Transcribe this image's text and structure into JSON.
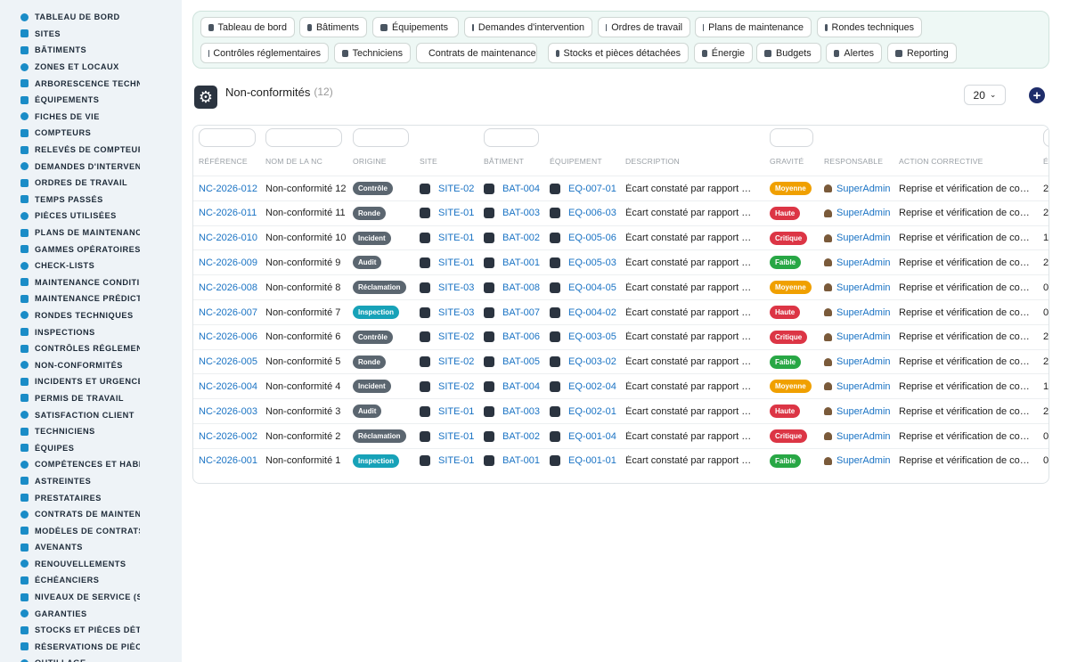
{
  "sidebar": {
    "items": [
      {
        "label": "TABLEAU DE BORD",
        "icon": "dashboard-icon"
      },
      {
        "label": "SITES",
        "icon": "map-pin-icon"
      },
      {
        "label": "BÂTIMENTS",
        "icon": "building-icon"
      },
      {
        "label": "ZONES ET LOCAUX",
        "icon": "map-icon"
      },
      {
        "label": "ARBORESCENCE TECHNIQUE",
        "icon": "tree-icon"
      },
      {
        "label": "ÉQUIPEMENTS",
        "icon": "cogs-icon"
      },
      {
        "label": "FICHES DE VIE",
        "icon": "history-icon"
      },
      {
        "label": "COMPTEURS",
        "icon": "gauge-icon"
      },
      {
        "label": "RELEVÉS DE COMPTEURS",
        "icon": "list-icon"
      },
      {
        "label": "DEMANDES D'INTERVENTION",
        "icon": "question-icon"
      },
      {
        "label": "ORDRES DE TRAVAIL",
        "icon": "clipboard-icon"
      },
      {
        "label": "TEMPS PASSÉS",
        "icon": "clock-icon"
      },
      {
        "label": "PIÈCES UTILISÉES",
        "icon": "boxes-icon"
      },
      {
        "label": "PLANS DE MAINTENANCE",
        "icon": "calendar-icon"
      },
      {
        "label": "GAMMES OPÉRATOIRES",
        "icon": "list-check-icon"
      },
      {
        "label": "CHECK-LISTS",
        "icon": "checklist-icon"
      },
      {
        "label": "MAINTENANCE CONDITIONNELLE",
        "icon": "thermometer-icon"
      },
      {
        "label": "MAINTENANCE PRÉDICTIVE",
        "icon": "chart-icon"
      },
      {
        "label": "RONDES TECHNIQUES",
        "icon": "route-icon"
      },
      {
        "label": "INSPECTIONS",
        "icon": "search-icon"
      },
      {
        "label": "CONTRÔLES RÉGLEMENTAIRES",
        "icon": "clipboard-check-icon"
      },
      {
        "label": "NON-CONFORMITÉS",
        "icon": "alert-circle-icon"
      },
      {
        "label": "INCIDENTS ET URGENCES",
        "icon": "warning-icon"
      },
      {
        "label": "PERMIS DE TRAVAIL",
        "icon": "document-icon"
      },
      {
        "label": "SATISFACTION CLIENT",
        "icon": "smile-icon"
      },
      {
        "label": "TECHNICIENS",
        "icon": "hard-hat-icon"
      },
      {
        "label": "ÉQUIPES",
        "icon": "users-icon"
      },
      {
        "label": "COMPÉTENCES ET HABILITATIONS",
        "icon": "award-icon"
      },
      {
        "label": "ASTREINTES",
        "icon": "phone-icon"
      },
      {
        "label": "PRESTATAIRES",
        "icon": "handshake-icon"
      },
      {
        "label": "CONTRATS DE MAINTENANCE",
        "icon": "contract-icon"
      },
      {
        "label": "MODÈLES DE CONTRATS",
        "icon": "file-icon"
      },
      {
        "label": "AVENANTS",
        "icon": "file-plus-icon"
      },
      {
        "label": "RENOUVELLEMENTS",
        "icon": "refresh-icon"
      },
      {
        "label": "ÉCHÉANCIERS",
        "icon": "calendar-alt-icon"
      },
      {
        "label": "NIVEAUX DE SERVICE (SLA)",
        "icon": "stopwatch-icon"
      },
      {
        "label": "GARANTIES",
        "icon": "shield-icon"
      },
      {
        "label": "STOCKS ET PIÈCES DÉTACHÉES",
        "icon": "warehouse-icon"
      },
      {
        "label": "RÉSERVATIONS DE PIÈCES",
        "icon": "bookmark-icon"
      },
      {
        "label": "OUTILLAGE",
        "icon": "tools-icon"
      }
    ]
  },
  "nav": {
    "row1": [
      {
        "label": "Tableau de bord",
        "icon": "dashboard-icon"
      },
      {
        "label": "Bâtiments",
        "icon": "building-icon"
      },
      {
        "label": "Équipements",
        "icon": "cogs-icon"
      },
      {
        "label": "Demandes d'intervention",
        "icon": "question-icon"
      },
      {
        "label": "Ordres de travail",
        "icon": "clipboard-icon"
      },
      {
        "label": "Plans de maintenance",
        "icon": "calendar-icon"
      },
      {
        "label": "Rondes techniques",
        "icon": "route-icon"
      }
    ],
    "row2": [
      {
        "label": "Contrôles réglementaires",
        "icon": "clipboard-check-icon"
      },
      {
        "label": "Techniciens",
        "icon": "hard-hat-icon"
      },
      {
        "label": "Contrats de maintenance",
        "icon": "contract-icon"
      },
      {
        "label": "Stocks et pièces détachées",
        "icon": "boxes-icon"
      },
      {
        "label": "Énergie",
        "icon": "bolt-icon"
      },
      {
        "label": "Budgets",
        "icon": "money-icon"
      },
      {
        "label": "Alertes",
        "icon": "bell-icon"
      },
      {
        "label": "Reporting",
        "icon": "pie-chart-icon"
      }
    ]
  },
  "page": {
    "title": "Non-conformités",
    "count": "(12)",
    "per_page": "20",
    "add_label": "+"
  },
  "table": {
    "headers": [
      "RÉFÉRENCE",
      "NOM DE LA NC",
      "ORIGINE",
      "SITE",
      "BÂTIMENT",
      "ÉQUIPEMENT",
      "DESCRIPTION",
      "GRAVITÉ",
      "RESPONSABLE",
      "ACTION CORRECTIVE",
      "É"
    ],
    "origin_colors": {
      "Contrôle": "#5b6670",
      "Ronde": "#5b6670",
      "Incident": "#5b6670",
      "Audit": "#5b6670",
      "Réclamation": "#5b6670",
      "Inspection": "#17a2b8"
    },
    "severity_colors": {
      "Moyenne": "#f0a000",
      "Haute": "#dc3545",
      "Critique": "#dc3545",
      "Faible": "#28a745"
    },
    "rows": [
      {
        "ref": "NC-2026-012",
        "name": "Non-conformité 12",
        "origin": "Contrôle",
        "site": "SITE-02",
        "bat": "BAT-004",
        "eq": "EQ-007-01",
        "desc": "Écart constaté par rapport aux exigences",
        "sev": "Moyenne",
        "resp": "SuperAdmin",
        "action": "Reprise et vérification de conformité",
        "extra": "2"
      },
      {
        "ref": "NC-2026-011",
        "name": "Non-conformité 11",
        "origin": "Ronde",
        "site": "SITE-01",
        "bat": "BAT-003",
        "eq": "EQ-006-03",
        "desc": "Écart constaté par rapport aux exigences",
        "sev": "Haute",
        "resp": "SuperAdmin",
        "action": "Reprise et vérification de conformité",
        "extra": "2"
      },
      {
        "ref": "NC-2026-010",
        "name": "Non-conformité 10",
        "origin": "Incident",
        "site": "SITE-01",
        "bat": "BAT-002",
        "eq": "EQ-005-06",
        "desc": "Écart constaté par rapport aux exigences",
        "sev": "Critique",
        "resp": "SuperAdmin",
        "action": "Reprise et vérification de conformité",
        "extra": "1"
      },
      {
        "ref": "NC-2026-009",
        "name": "Non-conformité 9",
        "origin": "Audit",
        "site": "SITE-01",
        "bat": "BAT-001",
        "eq": "EQ-005-03",
        "desc": "Écart constaté par rapport aux exigences",
        "sev": "Faible",
        "resp": "SuperAdmin",
        "action": "Reprise et vérification de conformité",
        "extra": "2"
      },
      {
        "ref": "NC-2026-008",
        "name": "Non-conformité 8",
        "origin": "Réclamation",
        "site": "SITE-03",
        "bat": "BAT-008",
        "eq": "EQ-004-05",
        "desc": "Écart constaté par rapport aux exigences",
        "sev": "Moyenne",
        "resp": "SuperAdmin",
        "action": "Reprise et vérification de conformité",
        "extra": "0"
      },
      {
        "ref": "NC-2026-007",
        "name": "Non-conformité 7",
        "origin": "Inspection",
        "site": "SITE-03",
        "bat": "BAT-007",
        "eq": "EQ-004-02",
        "desc": "Écart constaté par rapport aux exigences",
        "sev": "Haute",
        "resp": "SuperAdmin",
        "action": "Reprise et vérification de conformité",
        "extra": "0"
      },
      {
        "ref": "NC-2026-006",
        "name": "Non-conformité 6",
        "origin": "Contrôle",
        "site": "SITE-02",
        "bat": "BAT-006",
        "eq": "EQ-003-05",
        "desc": "Écart constaté par rapport aux exigences",
        "sev": "Critique",
        "resp": "SuperAdmin",
        "action": "Reprise et vérification de conformité",
        "extra": "2"
      },
      {
        "ref": "NC-2026-005",
        "name": "Non-conformité 5",
        "origin": "Ronde",
        "site": "SITE-02",
        "bat": "BAT-005",
        "eq": "EQ-003-02",
        "desc": "Écart constaté par rapport aux exigences",
        "sev": "Faible",
        "resp": "SuperAdmin",
        "action": "Reprise et vérification de conformité",
        "extra": "2"
      },
      {
        "ref": "NC-2026-004",
        "name": "Non-conformité 4",
        "origin": "Incident",
        "site": "SITE-02",
        "bat": "BAT-004",
        "eq": "EQ-002-04",
        "desc": "Écart constaté par rapport aux exigences",
        "sev": "Moyenne",
        "resp": "SuperAdmin",
        "action": "Reprise et vérification de conformité",
        "extra": "1"
      },
      {
        "ref": "NC-2026-003",
        "name": "Non-conformité 3",
        "origin": "Audit",
        "site": "SITE-01",
        "bat": "BAT-003",
        "eq": "EQ-002-01",
        "desc": "Écart constaté par rapport aux exigences",
        "sev": "Haute",
        "resp": "SuperAdmin",
        "action": "Reprise et vérification de conformité",
        "extra": "2"
      },
      {
        "ref": "NC-2026-002",
        "name": "Non-conformité 2",
        "origin": "Réclamation",
        "site": "SITE-01",
        "bat": "BAT-002",
        "eq": "EQ-001-04",
        "desc": "Écart constaté par rapport aux exigences",
        "sev": "Critique",
        "resp": "SuperAdmin",
        "action": "Reprise et vérification de conformité",
        "extra": "0"
      },
      {
        "ref": "NC-2026-001",
        "name": "Non-conformité 1",
        "origin": "Inspection",
        "site": "SITE-01",
        "bat": "BAT-001",
        "eq": "EQ-001-01",
        "desc": "Écart constaté par rapport aux exigences",
        "sev": "Faible",
        "resp": "SuperAdmin",
        "action": "Reprise et vérification de conformité",
        "extra": "0"
      }
    ]
  }
}
